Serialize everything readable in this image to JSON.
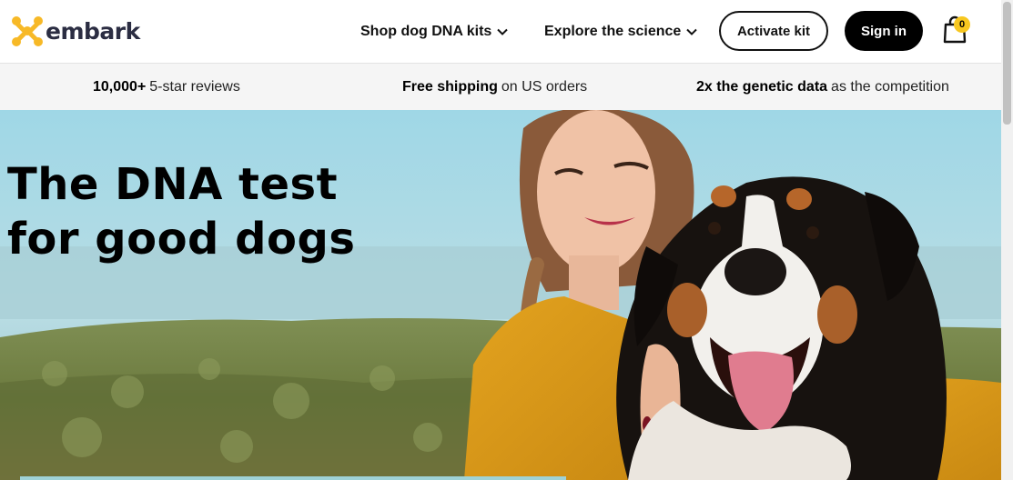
{
  "header": {
    "logo_text": "embark",
    "nav": [
      {
        "label": "Shop dog DNA kits",
        "icon": "chevron-down-icon"
      },
      {
        "label": "Explore the science",
        "icon": "chevron-down-icon"
      }
    ],
    "activate_label": "Activate kit",
    "signin_label": "Sign in",
    "cart_count": "0"
  },
  "promo": [
    {
      "bold": "10,000+",
      "text": "5-star reviews"
    },
    {
      "bold": "Free shipping",
      "text": "on US orders"
    },
    {
      "bold": "2x the genetic data",
      "text": "as the competition"
    }
  ],
  "hero": {
    "title_line1": "The DNA test",
    "title_line2": "for good dogs"
  },
  "colors": {
    "logo_mark": "#f7b927",
    "logo_text": "#2b2d42",
    "cart_badge": "#f7c71f",
    "signin_bg": "#000000",
    "promo_bg": "#f5f5f5"
  }
}
